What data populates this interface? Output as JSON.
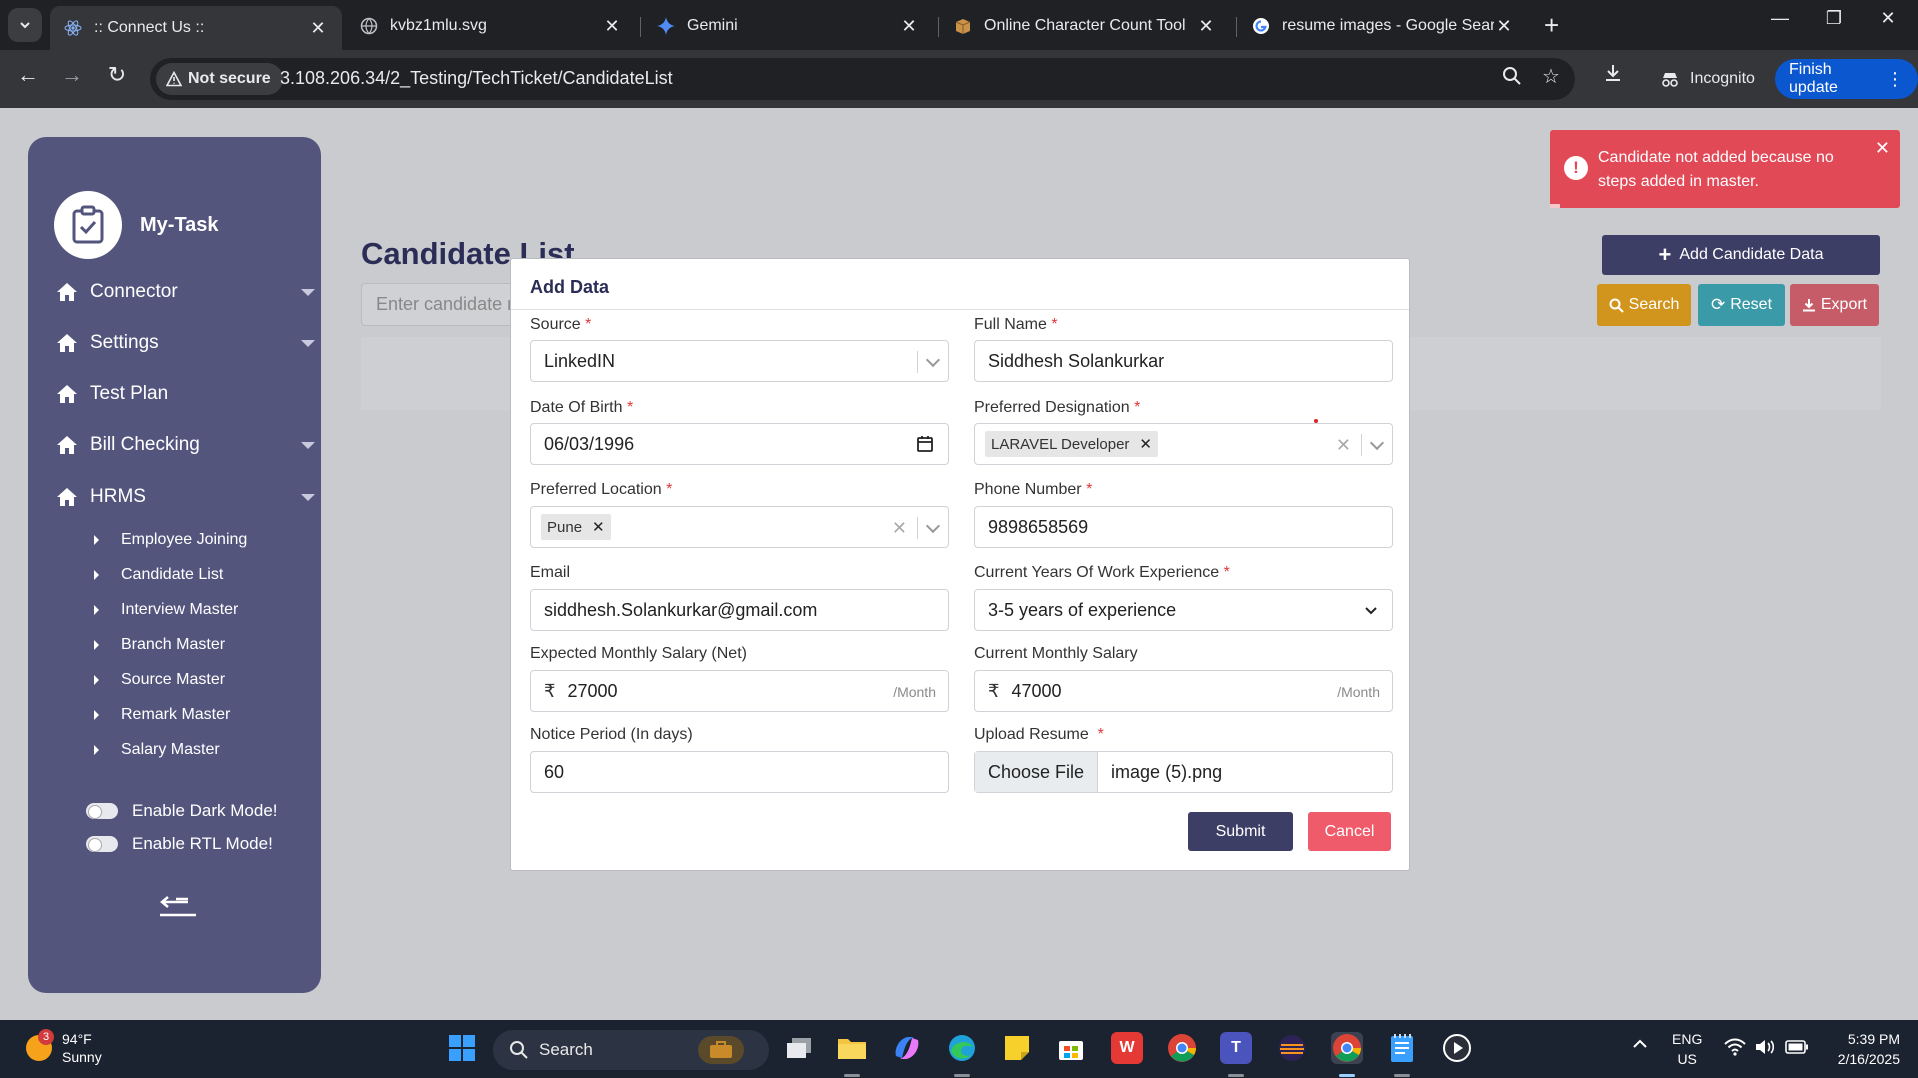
{
  "browser": {
    "tabs": [
      {
        "title": ":: Connect Us ::",
        "icon": "react-icon",
        "active": true
      },
      {
        "title": "kvbz1mlu.svg",
        "icon": "globe-icon",
        "active": false
      },
      {
        "title": "Gemini",
        "icon": "gemini-icon",
        "active": false
      },
      {
        "title": "Online Character Count Tool",
        "icon": "box-icon",
        "active": false
      },
      {
        "title": "resume images - Google Search",
        "icon": "google-icon",
        "active": false
      }
    ],
    "security_label": "Not secure",
    "url": "3.108.206.34/2_Testing/TechTicket/CandidateList",
    "incognito_label": "Incognito",
    "finish_update_label": "Finish update",
    "finish_update_color": "#0b57d0"
  },
  "sidebar": {
    "brand": "My-Task",
    "bg_color": "#54557d",
    "items": [
      {
        "label": "Connector",
        "has_caret": true
      },
      {
        "label": "Settings",
        "has_caret": true
      },
      {
        "label": "Test Plan",
        "has_caret": false
      },
      {
        "label": "Bill Checking",
        "has_caret": true
      },
      {
        "label": "HRMS",
        "has_caret": true
      }
    ],
    "hrms_sub_items": [
      "Employee Joining",
      "Candidate List",
      "Interview Master",
      "Branch Master",
      "Source Master",
      "Remark Master",
      "Salary Master"
    ],
    "toggles": {
      "dark_mode": "Enable Dark Mode!",
      "rtl_mode": "Enable RTL Mode!"
    }
  },
  "main": {
    "title": "Candidate List",
    "search_placeholder": "Enter candidate n",
    "add_button": "Add Candidate Data",
    "search_button": "Search",
    "reset_button": "Reset",
    "export_button": "Export"
  },
  "toast": {
    "message": "Candidate not added because no steps added in master.",
    "color": "#e24957"
  },
  "modal": {
    "title": "Add Data",
    "source": {
      "label": "Source",
      "value": "LinkedIN"
    },
    "full_name": {
      "label": "Full Name",
      "value": "Siddhesh Solankurkar"
    },
    "dob": {
      "label": "Date Of Birth",
      "value": "06/03/1996"
    },
    "designation": {
      "label": "Preferred Designation",
      "chip": "LARAVEL Developer"
    },
    "location": {
      "label": "Preferred Location",
      "chip": "Pune"
    },
    "phone": {
      "label": "Phone Number",
      "value": "9898658569"
    },
    "email": {
      "label": "Email",
      "value": "siddhesh.Solankurkar@gmail.com"
    },
    "experience": {
      "label": "Current Years Of Work Experience",
      "value": "3-5 years of experience"
    },
    "expected_salary": {
      "label": "Expected Monthly Salary (Net)",
      "value": "27000",
      "currency": "₹",
      "suffix": "/Month"
    },
    "current_salary": {
      "label": "Current Monthly Salary",
      "value": "47000",
      "currency": "₹",
      "suffix": "/Month"
    },
    "notice": {
      "label": "Notice Period (In days)",
      "value": "60"
    },
    "resume": {
      "label": "Upload Resume",
      "button": "Choose File",
      "file": "image (5).png"
    },
    "submit": "Submit",
    "cancel": "Cancel"
  },
  "taskbar": {
    "weather_temp": "94°F",
    "weather_desc": "Sunny",
    "weather_badge": "3",
    "search_label": "Search",
    "lang_top": "ENG",
    "lang_bottom": "US",
    "time": "5:39 PM",
    "date": "2/16/2025"
  }
}
